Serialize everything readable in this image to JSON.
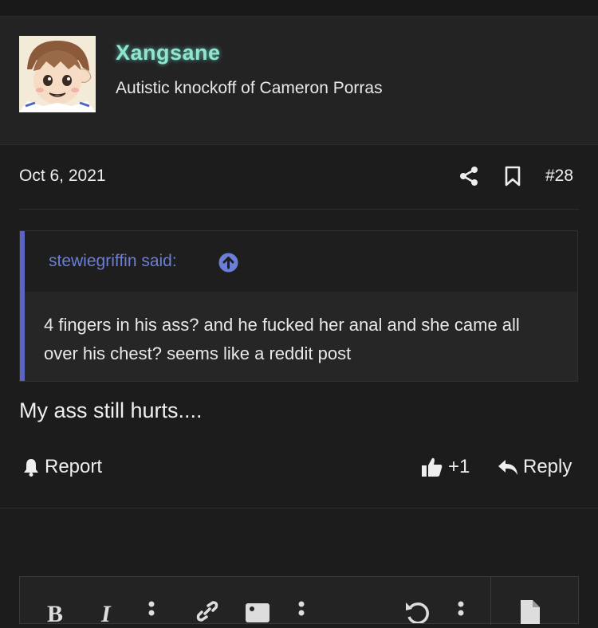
{
  "post": {
    "username": "Xangsane",
    "user_title": "Autistic knockoff of Cameron Porras",
    "date": "Oct 6, 2021",
    "post_number": "#28",
    "quote": {
      "author_label": "stewiegriffin said:",
      "text": "4 fingers in his ass? and he fucked her anal and she came all over his chest? seems like a reddit post"
    },
    "message": "My ass still hurts....",
    "actions": {
      "report": "Report",
      "like_count": "+1",
      "reply": "Reply"
    }
  },
  "editor": {
    "bold": "B",
    "italic": "I"
  },
  "colors": {
    "username_glow": "#8fe6d0",
    "quote_accent": "#5b63c3",
    "quote_author": "#6b7fd6"
  }
}
